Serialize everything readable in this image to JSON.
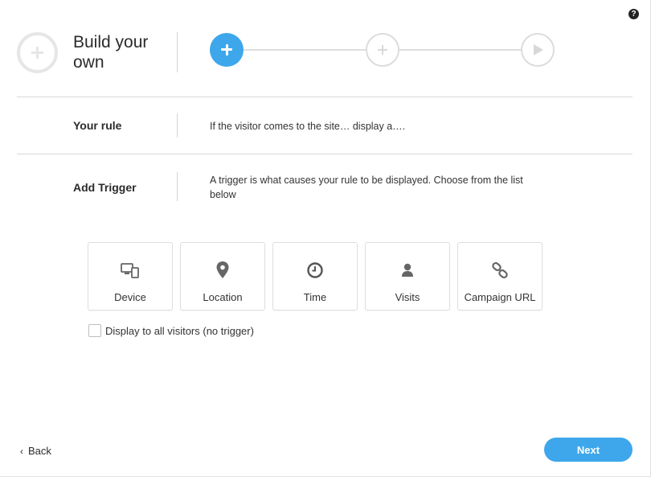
{
  "help": {
    "glyph": "?"
  },
  "header": {
    "title": "Build your own"
  },
  "stepper": {
    "steps": [
      "add",
      "add",
      "play"
    ],
    "active_index": 0,
    "accent": "#3ea7eb"
  },
  "rule": {
    "label": "Your rule",
    "text": "If the visitor comes to the site… display a…."
  },
  "trigger": {
    "label": "Add Trigger",
    "description": "A trigger is what causes your rule to be displayed. Choose from the list below",
    "options": [
      {
        "label": "Device",
        "icon": "device-icon"
      },
      {
        "label": "Location",
        "icon": "location-pin-icon"
      },
      {
        "label": "Time",
        "icon": "clock-icon"
      },
      {
        "label": "Visits",
        "icon": "user-icon"
      },
      {
        "label": "Campaign URL",
        "icon": "link-icon"
      }
    ]
  },
  "no_trigger": {
    "label": "Display to all visitors (no trigger)",
    "checked": false
  },
  "footer": {
    "back_label": "Back",
    "back_glyph": "‹",
    "next_label": "Next"
  }
}
